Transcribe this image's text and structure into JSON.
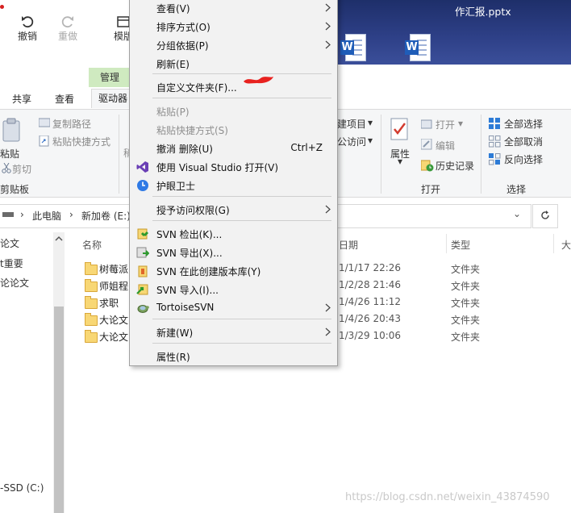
{
  "colors": {
    "ribbon_bg": "#f5f6f7",
    "manage_tab": "#cfeac0",
    "menu_bg": "#f2f2f2",
    "folder": "#f8d775",
    "word_blue": "#1f5db8",
    "accent_vs": "#6a3fb5",
    "redaction": "#e8221f"
  },
  "desktop": {
    "file_name": "作汇报.pptx",
    "word_badge": "W"
  },
  "quick_toolbar": {
    "undo": "撤销",
    "redo": "重做",
    "mode": "模版"
  },
  "ribbon_tabs": {
    "share": "共享",
    "view": "查看",
    "drive_tools": "驱动器",
    "manage": "管理"
  },
  "ribbon": {
    "paste": "粘贴",
    "copy_path": "复制路径",
    "paste_shortcut": "粘贴快捷方式",
    "cut": "剪切",
    "clipboard_group": "剪贴板",
    "organize_fragment": "稍",
    "new_item": "建项目",
    "easy_access": "公访问",
    "properties": "属性",
    "open": "打开",
    "edit": "编辑",
    "history": "历史记录",
    "open_group": "打开",
    "select_all": "全部选择",
    "select_none": "全部取消",
    "invert_select": "反向选择",
    "select_group": "选择"
  },
  "address": {
    "this_pc": "此电脑",
    "volume": "新加卷 (E:)"
  },
  "nav_pane": {
    "items": [
      "论文",
      "t重要",
      "论论文"
    ],
    "drive": "-SSD (C:)"
  },
  "file_list": {
    "columns": {
      "name": "名称",
      "date": "日期",
      "type": "类型",
      "size": "大"
    },
    "rows": [
      {
        "name": "树莓派",
        "date": "1/1/17 22:26",
        "type": "文件夹"
      },
      {
        "name": "师姐程",
        "date": "1/2/28 21:46",
        "type": "文件夹"
      },
      {
        "name": "求职",
        "date": "1/4/26 11:12",
        "type": "文件夹"
      },
      {
        "name": "大论文",
        "date": "1/4/26 20:43",
        "type": "文件夹"
      },
      {
        "name": "大论文",
        "date": "1/3/29 10:06",
        "type": "文件夹"
      }
    ]
  },
  "context_menu": {
    "view": "查看(V)",
    "sort_by": "排序方式(O)",
    "group_by": "分组依据(P)",
    "refresh": "刷新(E)",
    "customize_folder": "自定义文件夹(F)...",
    "paste": "粘贴(P)",
    "paste_shortcut": "粘贴快捷方式(S)",
    "undo_delete": "撤消 删除(U)",
    "undo_shortcut": "Ctrl+Z",
    "open_vs": "使用 Visual Studio 打开(V)",
    "eye_guard": "护眼卫士",
    "grant_access": "授予访问权限(G)",
    "svn_checkout": "SVN 检出(K)...",
    "svn_export": "SVN 导出(X)...",
    "svn_create_repo": "SVN 在此创建版本库(Y)",
    "svn_import": "SVN 导入(I)...",
    "tortoise": "TortoiseSVN",
    "new": "新建(W)",
    "properties": "属性(R)"
  },
  "watermark": "https://blog.csdn.net/weixin_43874590"
}
